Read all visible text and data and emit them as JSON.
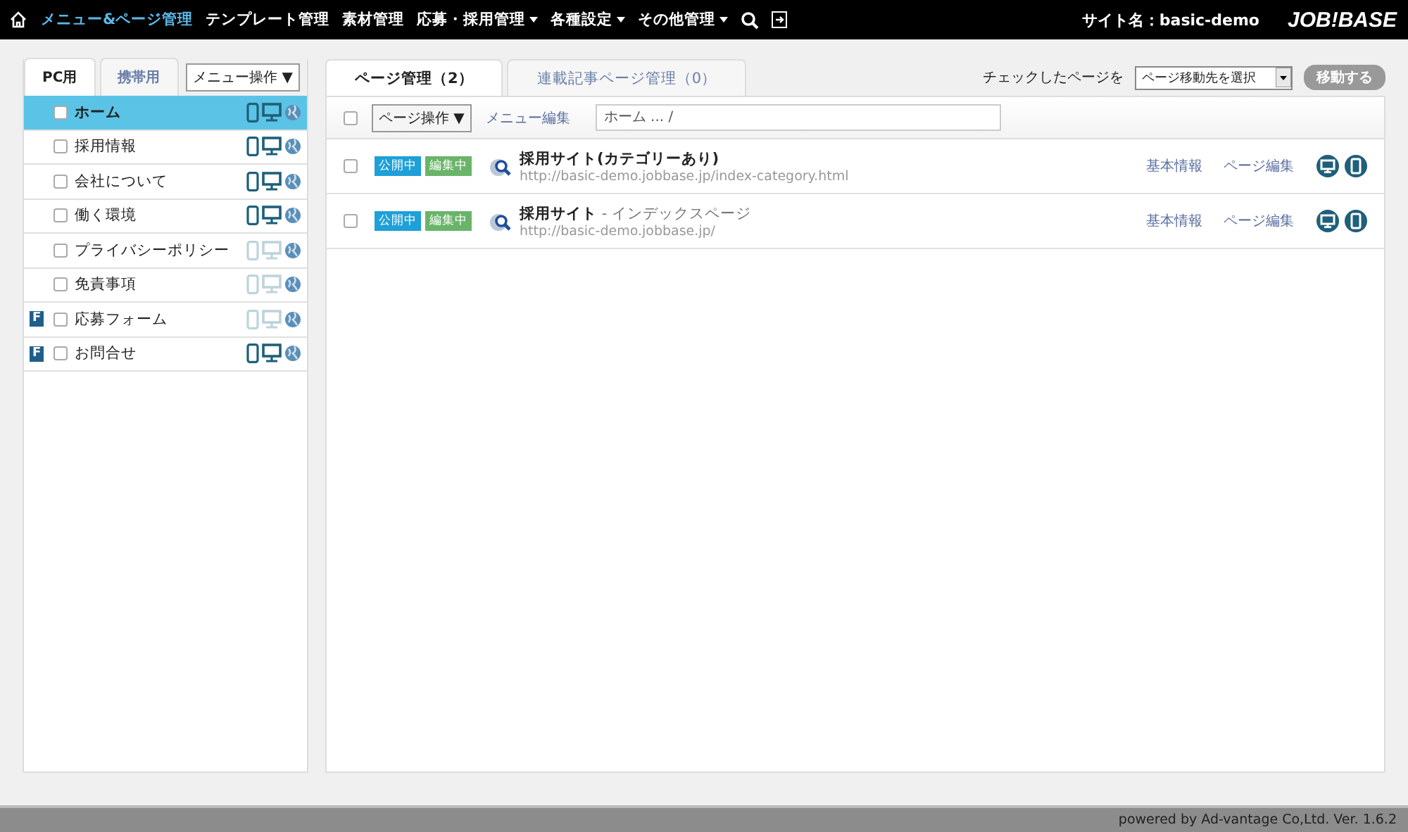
{
  "nav": {
    "items": [
      {
        "label": "メニュー&ページ管理",
        "selected": true,
        "dropdown": false
      },
      {
        "label": "テンプレート管理",
        "selected": false,
        "dropdown": false
      },
      {
        "label": "素材管理",
        "selected": false,
        "dropdown": false
      },
      {
        "label": "応募・採用管理",
        "selected": false,
        "dropdown": true
      },
      {
        "label": "各種設定",
        "selected": false,
        "dropdown": true
      },
      {
        "label": "その他管理",
        "selected": false,
        "dropdown": true
      }
    ],
    "site_name": "サイト名：basic-demo",
    "logo": "JOB!BASE"
  },
  "sidebar": {
    "tabs": [
      {
        "label": "PC用",
        "selected": true
      },
      {
        "label": "携帯用",
        "selected": false
      }
    ],
    "menu_button": "メニュー操作 ▼",
    "items": [
      {
        "label": "ホーム",
        "selected": true,
        "checked": false,
        "mobile": true,
        "pc": true
      },
      {
        "label": "採用情報",
        "selected": false,
        "checked": false,
        "mobile": true,
        "pc": true
      },
      {
        "label": "会社について",
        "selected": false,
        "checked": false,
        "mobile": true,
        "pc": true
      },
      {
        "label": "働く環境",
        "selected": false,
        "checked": false,
        "mobile": true,
        "pc": true
      },
      {
        "label": "プライバシーポリシー",
        "selected": false,
        "checked": false,
        "mobile": false,
        "pc": false
      },
      {
        "label": "免責事項",
        "selected": false,
        "checked": false,
        "mobile": false,
        "pc": false
      },
      {
        "label": "応募フォーム",
        "selected": false,
        "form_badge": "F",
        "checked": false,
        "mobile": false,
        "pc": false
      },
      {
        "label": "お問合せ",
        "selected": false,
        "form_badge": "F",
        "checked": false,
        "mobile": true,
        "pc": true
      }
    ]
  },
  "main": {
    "tabs": [
      {
        "label": "ページ管理（2）",
        "selected": true
      },
      {
        "label": "連載記事ページ管理（0）",
        "selected": false
      }
    ],
    "move_label": "チェックしたページを",
    "move_select": "ページ移動先を選択",
    "move_button": "移動する",
    "toolbar": {
      "page_ops": "ページ操作 ▼",
      "menu_edit": "メニュー編集",
      "path_placeholder": "ホーム ... /",
      "checked": false
    },
    "rows": [
      {
        "checked": false,
        "badges": [
          "公開中",
          "編集中"
        ],
        "title": "採用サイト(カテゴリーあり)",
        "url": "http://basic-demo.jobbase.jp/index-category.html",
        "links": [
          "基本情報",
          "ページ編集"
        ]
      },
      {
        "checked": false,
        "badges": [
          "公開中",
          "編集中"
        ],
        "title": "採用サイト",
        "subtitle": " - インデックスページ",
        "url": "http://basic-demo.jobbase.jp/",
        "links": [
          "基本情報",
          "ページ編集"
        ]
      }
    ]
  },
  "footer": "powered by Ad-vantage Co,Ltd. Ver. 1.6.2"
}
